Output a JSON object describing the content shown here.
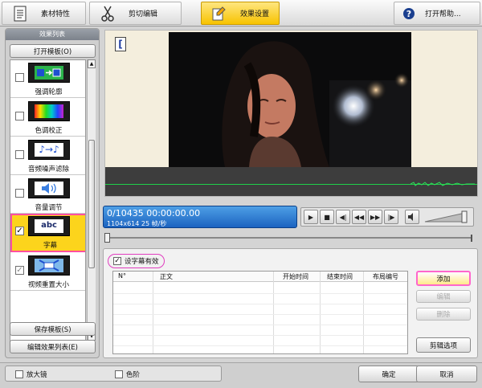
{
  "toolbar": {
    "tabs": [
      {
        "label": "素材特性",
        "icon": "document-icon"
      },
      {
        "label": "剪切编辑",
        "icon": "scissors-icon"
      },
      {
        "label": "效果设置",
        "icon": "effects-icon"
      },
      {
        "label": "打开帮助...",
        "icon": "help-icon"
      }
    ],
    "active_tab": "效果设置"
  },
  "effects_panel": {
    "title": "效果列表",
    "open_template": "打开模板(O)",
    "items": [
      {
        "name": "强调轮廓",
        "checked": false
      },
      {
        "name": "色调校正",
        "checked": false
      },
      {
        "name": "音频噪声滤除",
        "checked": false
      },
      {
        "name": "音量调节",
        "checked": false
      },
      {
        "name": "字幕",
        "checked": true,
        "thumb_text": "abc",
        "selected": true
      },
      {
        "name": "视频重置大小",
        "checked": true
      }
    ],
    "save_template": "保存模板(S)",
    "edit_list": "编辑效果列表(E)"
  },
  "preview": {
    "bracket": "[",
    "timecode": "0/10435  00:00:00.00",
    "resolution": "1104x614 25  帧/秒"
  },
  "subtitle": {
    "enable_label": "设字幕有效",
    "enabled": true,
    "columns": [
      "N°",
      "正文",
      "开始时间",
      "结束时间",
      "布局编号"
    ],
    "rows": [],
    "buttons": {
      "add": "添加",
      "edit": "编辑",
      "delete": "删除",
      "options": "剪辑选项"
    }
  },
  "footer": {
    "magnifier": "放大镜",
    "color_level": "色阶",
    "ok": "确定",
    "cancel": "取消"
  },
  "colors": {
    "accent_yellow": "#f7c300",
    "highlight_pink": "#ff4fa0",
    "timecode_blue": "#1b63c0",
    "wave_green": "#1fd04a"
  }
}
